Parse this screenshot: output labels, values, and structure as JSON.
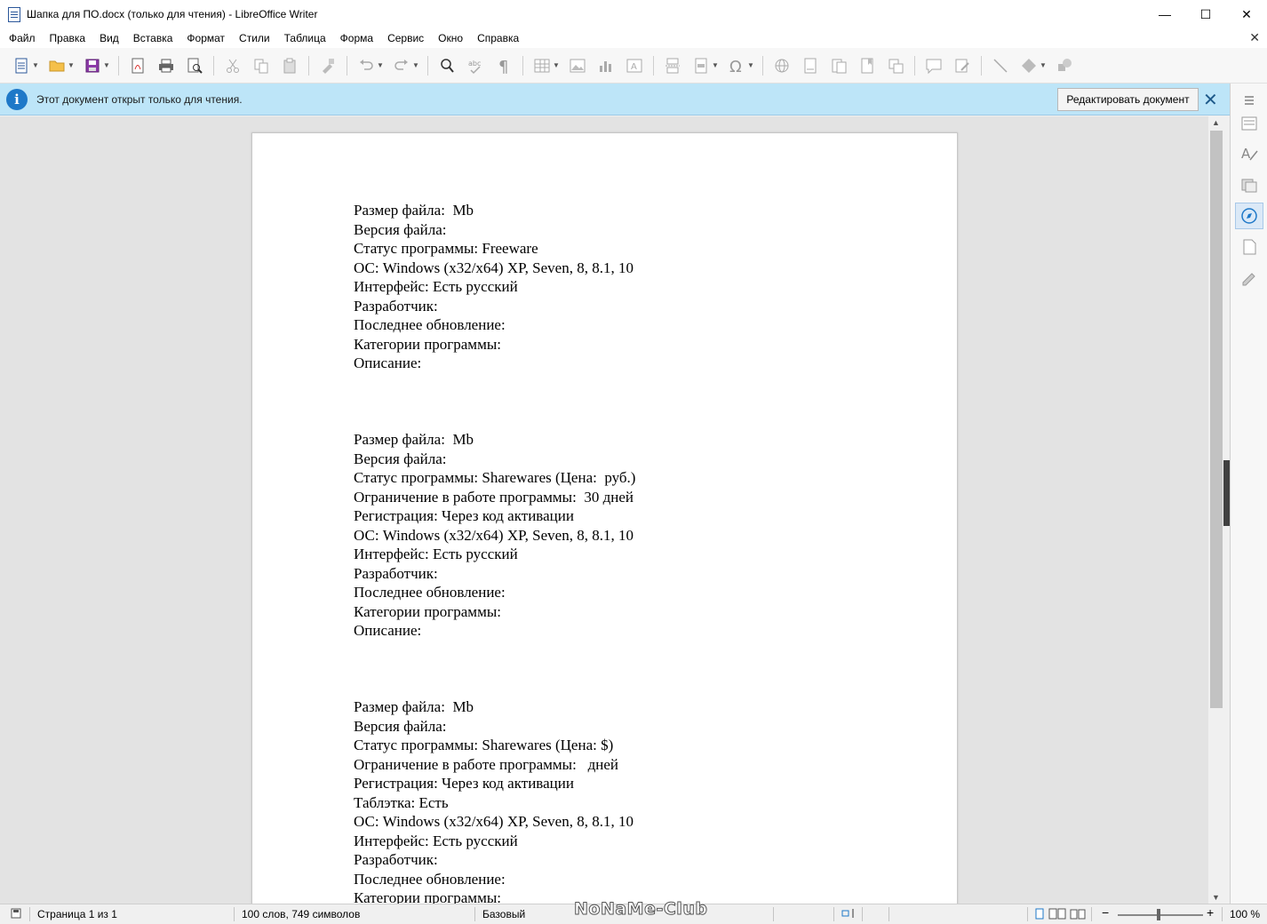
{
  "window": {
    "title": "Шапка для ПО.docx (только для чтения) - LibreOffice Writer",
    "minimize_glyph": "—",
    "maximize_glyph": "☐",
    "close_glyph": "✕"
  },
  "menu": {
    "items": [
      "Файл",
      "Правка",
      "Вид",
      "Вставка",
      "Формат",
      "Стили",
      "Таблица",
      "Форма",
      "Сервис",
      "Окно",
      "Справка"
    ],
    "doc_close_glyph": "✕"
  },
  "infobar": {
    "message": "Этот документ открыт только для чтения.",
    "edit_button": "Редактировать документ",
    "close_glyph": "✕",
    "info_glyph": "i"
  },
  "document": {
    "lines": [
      "Размер файла:  Mb",
      "Версия файла:",
      "Статус программы: Freeware",
      "ОС: Windows (x32/x64) XP, Seven, 8, 8.1, 10",
      "Интерфейс: Есть русский",
      "Разработчик:",
      "Последнее обновление:",
      "Категории программы:",
      "Описание:",
      "",
      "",
      "",
      "Размер файла:  Mb",
      "Версия файла:",
      "Статус программы: Sharewares (Цена:  руб.)",
      "Ограничение в работе программы:  30 дней",
      "Регистрация: Через код активации",
      "ОС: Windows (x32/x64) XP, Seven, 8, 8.1, 10",
      "Интерфейс: Есть русский",
      "Разработчик:",
      "Последнее обновление:",
      "Категории программы:",
      "Описание:",
      "",
      "",
      "",
      "Размер файла:  Mb",
      "Версия файла:",
      "Статус программы: Sharewares (Цена: $)",
      "Ограничение в работе программы:   дней",
      "Регистрация: Через код активации",
      "Таблэтка: Есть",
      "ОС: Windows (x32/x64) XP, Seven, 8, 8.1, 10",
      "Интерфейс: Есть русский",
      "Разработчик:",
      "Последнее обновление:",
      "Категории программы:"
    ]
  },
  "statusbar": {
    "page": "Страница 1 из 1",
    "words": "100 слов, 749 символов",
    "style": "Базовый",
    "watermark": "NoNaMe-Club",
    "zoom": "100 %",
    "zoom_minus": "−",
    "zoom_plus": "+"
  },
  "colors": {
    "infobar_bg": "#bde5f8",
    "info_icon": "#1e78c8",
    "accent_blue": "#2b579a",
    "page_bg": "#ffffff",
    "canvas_bg": "#e3e3e3"
  }
}
